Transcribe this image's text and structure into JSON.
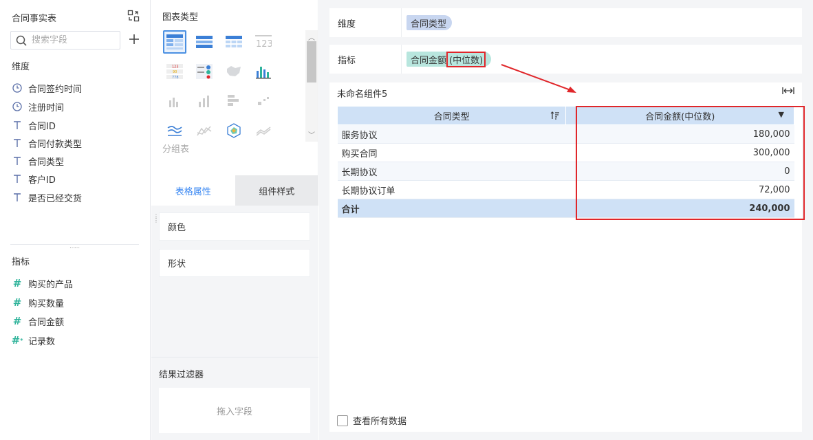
{
  "left": {
    "title": "合同事实表",
    "search_placeholder": "搜索字段",
    "dimensions_header": "维度",
    "dimensions": [
      {
        "label": "合同签约时间",
        "icon": "clock-icon"
      },
      {
        "label": "注册时间",
        "icon": "clock-icon"
      },
      {
        "label": "合同ID",
        "icon": "text-field-icon"
      },
      {
        "label": "合同付款类型",
        "icon": "text-field-icon"
      },
      {
        "label": "合同类型",
        "icon": "text-field-icon"
      },
      {
        "label": "客户ID",
        "icon": "text-field-icon"
      },
      {
        "label": "是否已经交货",
        "icon": "text-field-icon"
      }
    ],
    "measures_header": "指标",
    "measures": [
      {
        "label": "购买的产品",
        "icon": "hash-icon"
      },
      {
        "label": "购买数量",
        "icon": "hash-icon"
      },
      {
        "label": "合同金额",
        "icon": "hash-icon"
      },
      {
        "label": "记录数",
        "icon": "hash-star-icon"
      }
    ]
  },
  "middle": {
    "chart_types_title": "图表类型",
    "group_table_label": "分组表",
    "tabs": {
      "table_props": "表格属性",
      "component_style": "组件样式"
    },
    "props": {
      "color": "颜色",
      "shape": "形状"
    },
    "result_filter_title": "结果过滤器",
    "drop_hint": "拖入字段"
  },
  "right": {
    "dimension_label": "维度",
    "dimension_pill": "合同类型",
    "measure_label": "指标",
    "measure_pill_main": "合同金额",
    "measure_pill_agg": "(中位数)",
    "widget_title": "未命名组件5",
    "table": {
      "headers": [
        "合同类型",
        "合同金额(中位数)"
      ],
      "rows": [
        [
          "服务协议",
          "180,000"
        ],
        [
          "购买合同",
          "300,000"
        ],
        [
          "长期协议",
          "0"
        ],
        [
          "长期协议订单",
          "72,000"
        ]
      ],
      "total": [
        "合计",
        "240,000"
      ]
    },
    "show_all_data": "查看所有数据",
    "colors": {
      "accent": "#3685f2",
      "highlight": "#e0262a",
      "header_bg": "#cfe1f6"
    }
  }
}
